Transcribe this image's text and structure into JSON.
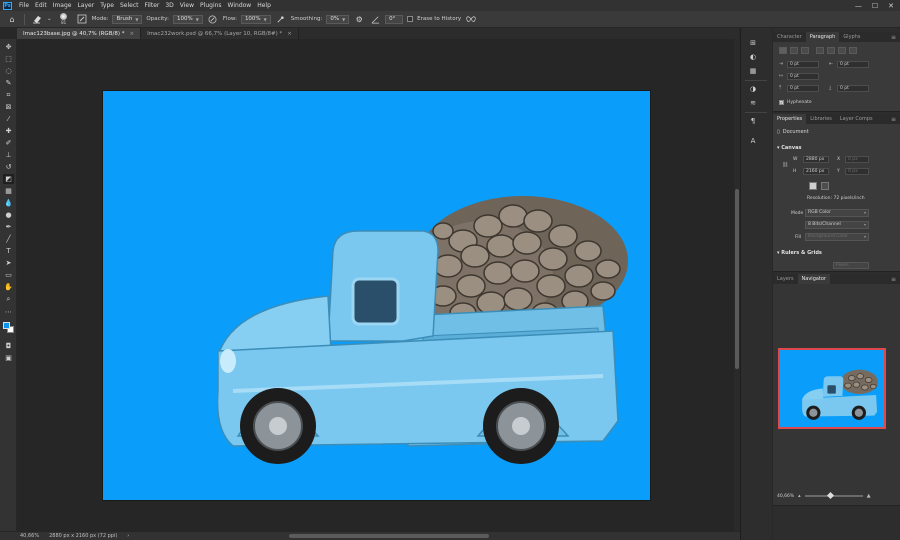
{
  "menubar": {
    "logo": "Ps",
    "items": [
      "File",
      "Edit",
      "Image",
      "Layer",
      "Type",
      "Select",
      "Filter",
      "3D",
      "View",
      "Plugins",
      "Window",
      "Help"
    ],
    "window_controls": [
      "—",
      "☐",
      "✕"
    ]
  },
  "options": {
    "brush_size": "81",
    "mode_label": "Mode:",
    "mode_value": "Brush",
    "opacity_label": "Opacity:",
    "opacity_value": "100%",
    "flow_label": "Flow:",
    "flow_value": "100%",
    "smoothing_label": "Smoothing:",
    "smoothing_value": "0%",
    "angle_value": "0°",
    "erase_to_history_label": "Erase to History"
  },
  "tabs": [
    {
      "label": "Imac123base.jpg @ 40,7% (RGB/8) *",
      "close": "×"
    },
    {
      "label": "Imac232work.psd @ 66,7% (Layer 10, RGB/8#) *",
      "close": "×"
    }
  ],
  "status": {
    "zoom": "40,66%",
    "doc_info": "2880 px x 2160 px (72 ppi)",
    "arrow": "›"
  },
  "paragraph_panel": {
    "tabs": [
      "Character",
      "Paragraph",
      "Glyphs"
    ],
    "active_tab": "Paragraph",
    "menu": "≡",
    "indent_left": "0 pt",
    "indent_right": "0 pt",
    "indent_first": "0 pt",
    "space_before": "0 pt",
    "space_after": "0 pt",
    "hyphenate_label": "Hyphenate",
    "hyphenate_checked": "✓"
  },
  "properties_panel": {
    "tabs": [
      "Properties",
      "Libraries",
      "Layer Comps"
    ],
    "menu": "≡",
    "document_label": "Document",
    "canvas_section": "Canvas",
    "w_label": "W",
    "w_value": "2880 px",
    "h_label": "H",
    "h_value": "2160 px",
    "x_label": "X",
    "x_value": "0 px",
    "y_label": "Y",
    "y_value": "0 px",
    "resolution": "Resolution: 72 pixels/inch",
    "mode_label": "Mode",
    "mode_value": "RGB Color",
    "bits_value": "8 Bits/Channel",
    "fill_label": "Fill",
    "fill_value": "Background Color",
    "rulers_section": "Rulers & Grids",
    "rulers_unit": "Pixels"
  },
  "navigator_panel": {
    "tabs": [
      "Layers",
      "Navigator"
    ],
    "active_tab": "Navigator",
    "menu": "≡",
    "zoom": "40,66%"
  },
  "colors": {
    "canvas_blue": "#0a9dfa",
    "truck_blue": "#7ac8ef",
    "foreground": "#0a96f0",
    "background": "#ffffff",
    "nav_frame": "#e0484c"
  }
}
